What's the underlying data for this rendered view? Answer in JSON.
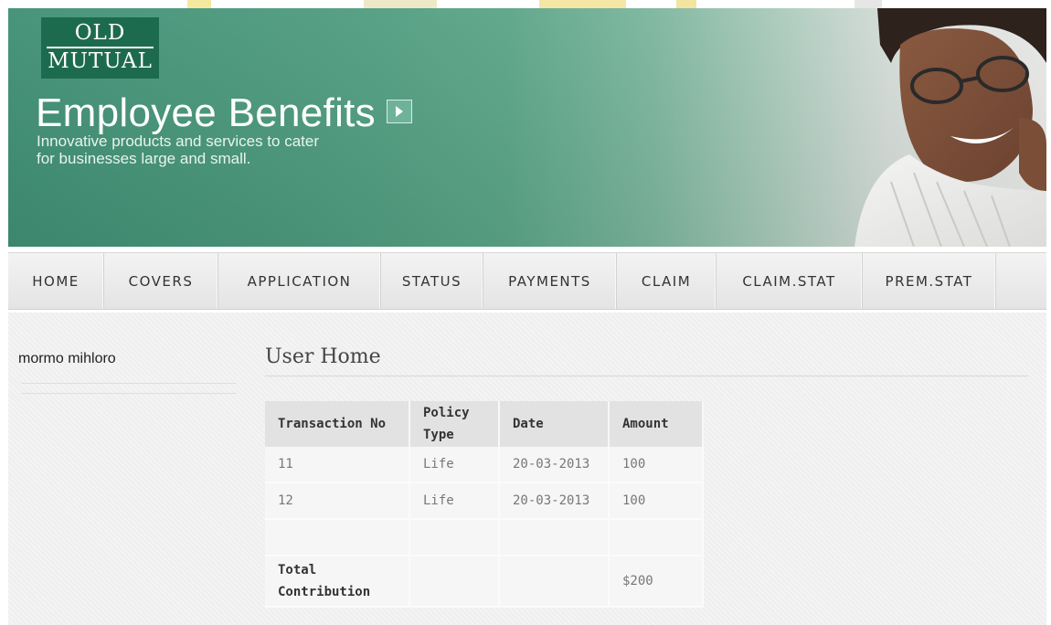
{
  "banner": {
    "logo_line1": "OLD",
    "logo_line2": "MUTUAL",
    "title": "Employee Benefits",
    "subtitle_line1": "Innovative products and services to cater",
    "subtitle_line2": "for businesses large and small.",
    "arrow_icon": "chevron-right-icon",
    "colors": {
      "banner_green": "#3f8f74",
      "logo_green": "#1d6b4e"
    }
  },
  "nav": {
    "items": [
      {
        "label": "HOME"
      },
      {
        "label": "COVERS"
      },
      {
        "label": "APPLICATION"
      },
      {
        "label": "STATUS"
      },
      {
        "label": "PAYMENTS"
      },
      {
        "label": "CLAIM"
      },
      {
        "label": "CLAIM.STAT"
      },
      {
        "label": "PREM.STAT"
      }
    ]
  },
  "sidebar": {
    "username": "mormo mihloro"
  },
  "main": {
    "title": "User Home",
    "table": {
      "headers": [
        "Transaction No",
        "Policy Type",
        "Date",
        "Amount"
      ],
      "rows": [
        [
          "11",
          "Life",
          "20-03-2013",
          "100"
        ],
        [
          "12",
          "Life",
          "20-03-2013",
          "100"
        ],
        [
          "",
          "",
          "",
          ""
        ]
      ],
      "total_label": "Total Contribution",
      "total_value": "$200"
    }
  }
}
